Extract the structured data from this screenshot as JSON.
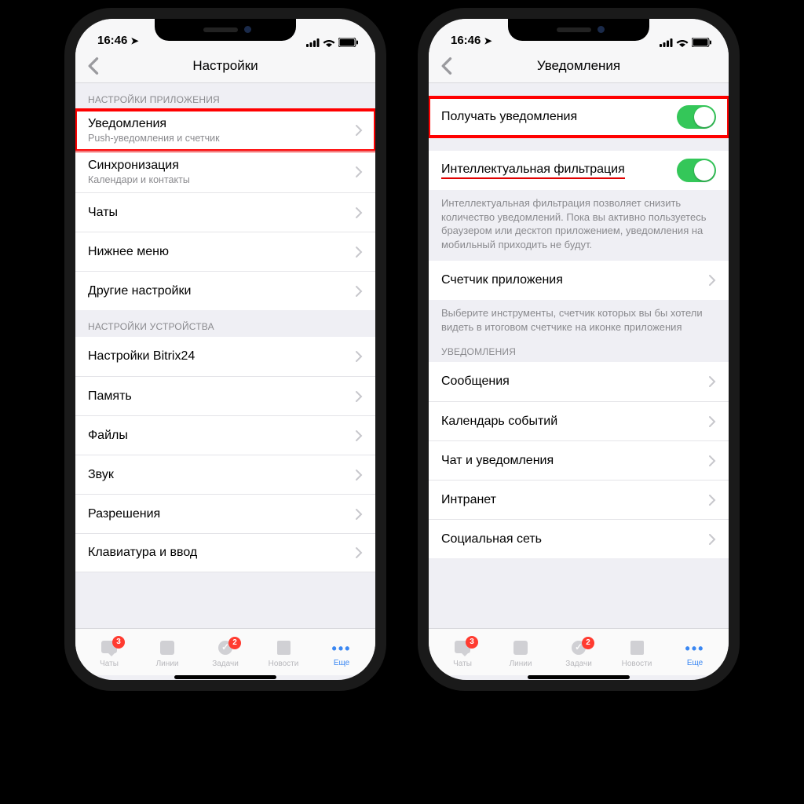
{
  "status": {
    "time": "16:46",
    "location_glyph": "➤",
    "signal": "ıll",
    "wifi": "wifi",
    "battery": "full"
  },
  "left": {
    "title": "Настройки",
    "section_app": "НАСТРОЙКИ ПРИЛОЖЕНИЯ",
    "rows_app": [
      {
        "title": "Уведомления",
        "sub": "Push-уведомления и счетчик"
      },
      {
        "title": "Синхронизация",
        "sub": "Календари и контакты"
      },
      {
        "title": "Чаты"
      },
      {
        "title": "Нижнее меню"
      },
      {
        "title": "Другие настройки"
      }
    ],
    "section_device": "НАСТРОЙКИ УСТРОЙСТВА",
    "rows_device": [
      {
        "title": "Настройки Bitrix24"
      },
      {
        "title": "Память"
      },
      {
        "title": "Файлы"
      },
      {
        "title": "Звук"
      },
      {
        "title": "Разрешения"
      },
      {
        "title": "Клавиатура и ввод"
      }
    ]
  },
  "right": {
    "title": "Уведомления",
    "row_receive": "Получать уведомления",
    "row_smart": "Интеллектуальная фильтрация",
    "smart_footer": "Интеллектуальная фильтрация позволяет снизить количество уведомлений. Пока вы активно пользуетесь браузером или десктоп приложением, уведомления на мобильный приходить не будут.",
    "row_counter": "Счетчик приложения",
    "counter_footer": "Выберите инструменты, счетчик которых вы бы хотели видеть в итоговом счетчике на иконке приложения",
    "section_notif": "УВЕДОМЛЕНИЯ",
    "rows_notif": [
      {
        "title": "Сообщения"
      },
      {
        "title": "Календарь событий"
      },
      {
        "title": "Чат и уведомления"
      },
      {
        "title": "Интранет"
      },
      {
        "title": "Социальная сеть"
      }
    ]
  },
  "tabs": {
    "chat": {
      "label": "Чаты",
      "badge": "3"
    },
    "lines": {
      "label": "Линии"
    },
    "tasks": {
      "label": "Задачи",
      "badge": "2"
    },
    "news": {
      "label": "Новости"
    },
    "more": {
      "label": "Еще"
    }
  }
}
